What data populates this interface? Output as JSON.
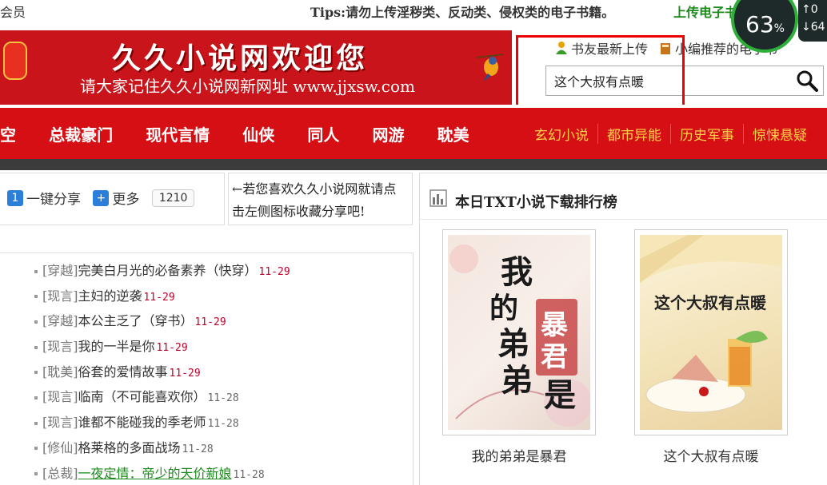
{
  "topbar": {
    "member": "会员",
    "tips": "Tips:请勿上传淫秽类、反动类、侵权类的电子书籍。",
    "upload": "上传电子书"
  },
  "widget": {
    "percent": "63",
    "percent_sign": "%",
    "line1": "↑0",
    "line2": "↓64"
  },
  "banner": {
    "title": "久久小说网欢迎您",
    "subtitle": "请大家记住久久小说网新网址 www.jjxsw.com"
  },
  "header_links": {
    "latest": "书友最新上传",
    "editor": "小编推荐的电子书"
  },
  "search": {
    "value": "这个大叔有点暖"
  },
  "nav": {
    "left": [
      "空",
      "总裁豪门",
      "现代言情",
      "仙侠",
      "同人",
      "网游",
      "耽美"
    ],
    "right": [
      "玄幻小说",
      "都市异能",
      "历史军事",
      "惊悚悬疑"
    ]
  },
  "share": {
    "one_click": "一键分享",
    "more": "更多",
    "count": "1210",
    "tip": "←若您喜欢久久小说网就请点击左侧图标收藏分享吧!"
  },
  "list": [
    {
      "cat": "[穿越]",
      "title": "完美白月光的必备素养（快穿）",
      "date": "11-29",
      "date_color": "red",
      "link_style": "normal"
    },
    {
      "cat": "[现言]",
      "title": "主妇的逆袭",
      "date": "11-29",
      "date_color": "red",
      "link_style": "normal"
    },
    {
      "cat": "[穿越]",
      "title": "本公主乏了（穿书）",
      "date": "11-29",
      "date_color": "red",
      "link_style": "normal"
    },
    {
      "cat": "[现言]",
      "title": "我的一半是你",
      "date": "11-29",
      "date_color": "red",
      "link_style": "normal"
    },
    {
      "cat": "[耽美]",
      "title": "俗套的爱情故事",
      "date": "11-29",
      "date_color": "red",
      "link_style": "normal"
    },
    {
      "cat": "[现言]",
      "title": "临南（不可能喜欢你）",
      "date": "11-28",
      "date_color": "gray",
      "link_style": "normal"
    },
    {
      "cat": "[现言]",
      "title": "谁都不能碰我的季老师",
      "date": "11-28",
      "date_color": "gray",
      "link_style": "normal"
    },
    {
      "cat": "[修仙]",
      "title": "格莱格的多面战场",
      "date": "11-28",
      "date_color": "gray",
      "link_style": "normal"
    },
    {
      "cat": "[总裁]",
      "title": "一夜定情：帝少的天价新娘",
      "date": "11-28",
      "date_color": "gray",
      "link_style": "green"
    }
  ],
  "ranking": {
    "title": "本日TXT小说下载排行榜",
    "books": [
      {
        "name": "我的弟弟是暴君",
        "cover_text": "我的弟弟是暴君"
      },
      {
        "name": "这个大叔有点暖",
        "cover_text": "这个大叔有点暖"
      }
    ]
  },
  "colors": {
    "brand_red": "#d50f14",
    "nav_secondary": "#ffd24a",
    "highlight_box": "#ee0000",
    "date_red": "#c0002a",
    "link_green": "#1a8a1a"
  }
}
